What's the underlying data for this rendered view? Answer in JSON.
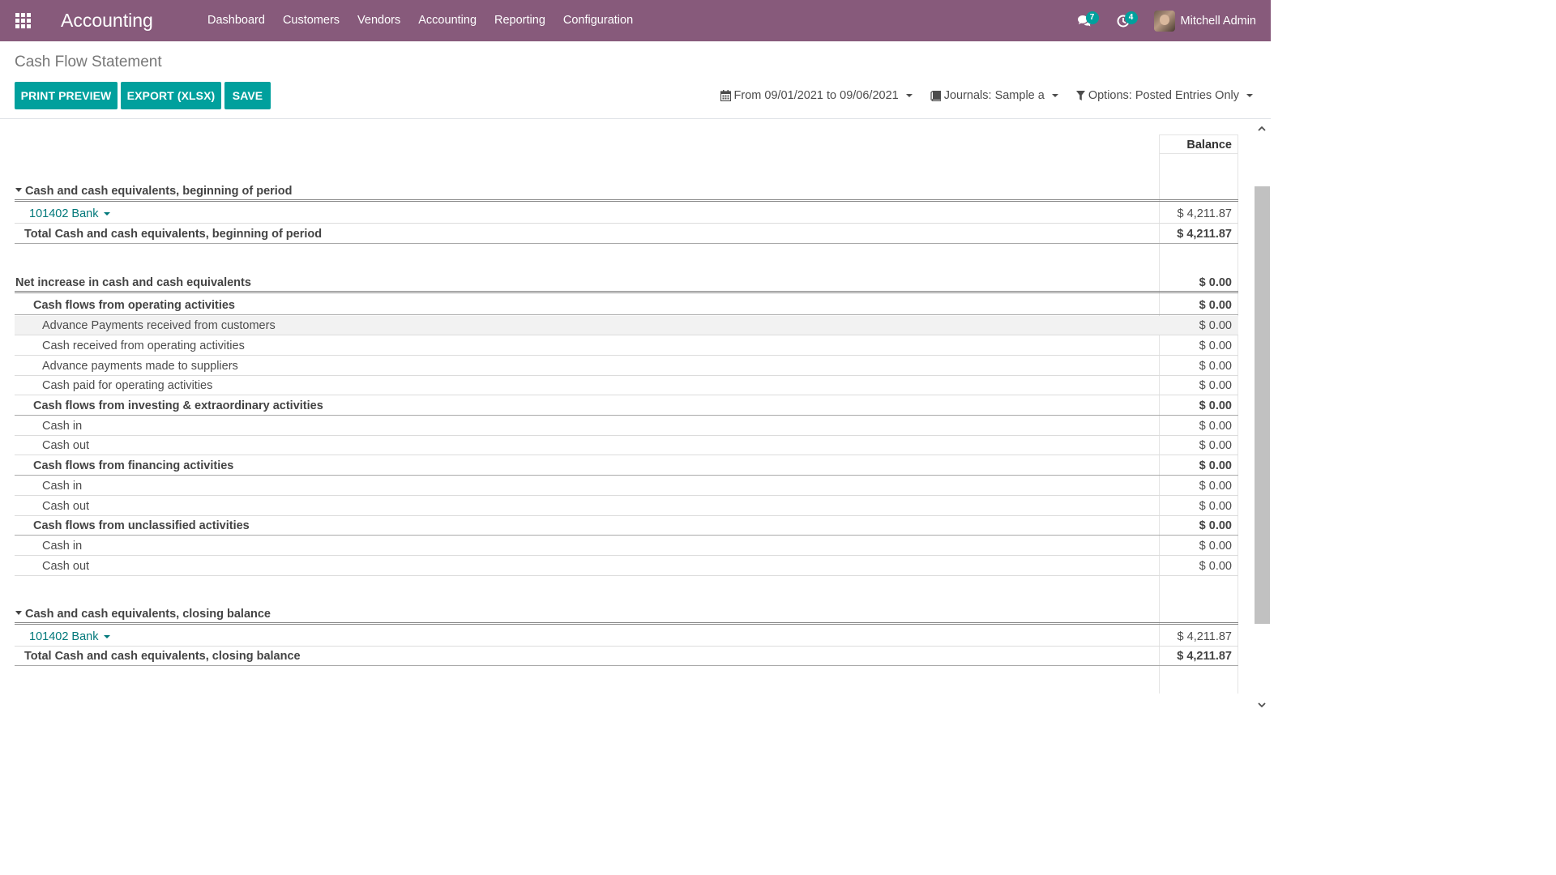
{
  "navbar": {
    "brand": "Accounting",
    "menu": [
      "Dashboard",
      "Customers",
      "Vendors",
      "Accounting",
      "Reporting",
      "Configuration"
    ],
    "messages_count": "7",
    "activities_count": "4",
    "user_name": "Mitchell Admin"
  },
  "page": {
    "title": "Cash Flow Statement",
    "buttons": {
      "print_preview": "PRINT PREVIEW",
      "export": "EXPORT (XLSX)",
      "save": "SAVE"
    },
    "filters": {
      "date": "From 09/01/2021 to 09/06/2021",
      "journals": "Journals: Sample a",
      "options": "Options: Posted Entries Only"
    }
  },
  "report": {
    "column_header": "Balance",
    "rows": [
      {
        "label": "Cash and cash equivalents, beginning of period",
        "amount": ""
      },
      {
        "label": "101402 Bank",
        "amount": "$ 4,211.87"
      },
      {
        "label": "Total Cash and cash equivalents, beginning of period",
        "amount": "$ 4,211.87"
      },
      {
        "label": "Net increase in cash and cash equivalents",
        "amount": "$ 0.00"
      },
      {
        "label": "Cash flows from operating activities",
        "amount": "$ 0.00"
      },
      {
        "label": "Advance Payments received from customers",
        "amount": "$ 0.00"
      },
      {
        "label": "Cash received from operating activities",
        "amount": "$ 0.00"
      },
      {
        "label": "Advance payments made to suppliers",
        "amount": "$ 0.00"
      },
      {
        "label": "Cash paid for operating activities",
        "amount": "$ 0.00"
      },
      {
        "label": "Cash flows from investing & extraordinary activities",
        "amount": "$ 0.00"
      },
      {
        "label": "Cash in",
        "amount": "$ 0.00"
      },
      {
        "label": "Cash out",
        "amount": "$ 0.00"
      },
      {
        "label": "Cash flows from financing activities",
        "amount": "$ 0.00"
      },
      {
        "label": "Cash in",
        "amount": "$ 0.00"
      },
      {
        "label": "Cash out",
        "amount": "$ 0.00"
      },
      {
        "label": "Cash flows from unclassified activities",
        "amount": "$ 0.00"
      },
      {
        "label": "Cash in",
        "amount": "$ 0.00"
      },
      {
        "label": "Cash out",
        "amount": "$ 0.00"
      },
      {
        "label": "Cash and cash equivalents, closing balance",
        "amount": ""
      },
      {
        "label": "101402 Bank",
        "amount": "$ 4,211.87"
      },
      {
        "label": "Total Cash and cash equivalents, closing balance",
        "amount": "$ 4,211.87"
      }
    ]
  },
  "colors": {
    "navbar": "#875a7b",
    "primary_button": "#00a09d",
    "account_link": "#00787a"
  }
}
